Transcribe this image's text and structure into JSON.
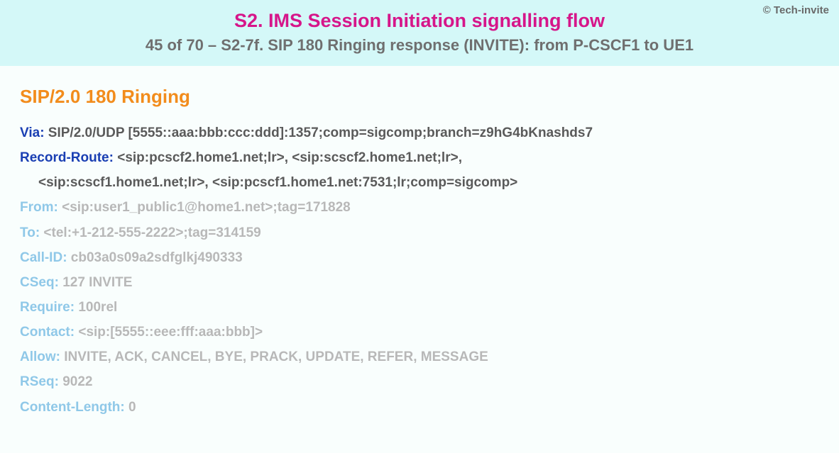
{
  "copyright": "© Tech-invite",
  "title": "S2. IMS Session Initiation signalling flow",
  "subtitle": "45 of 70 – S2-7f. SIP 180 Ringing response (INVITE): from P-CSCF1 to UE1",
  "status_line": "SIP/2.0 180 Ringing",
  "headers": {
    "via": {
      "label": "Via",
      "value": "SIP/2.0/UDP [5555::aaa:bbb:ccc:ddd]:1357;comp=sigcomp;branch=z9hG4bKnashds7"
    },
    "record_route": {
      "label": "Record-Route",
      "value_line1": "<sip:pcscf2.home1.net;lr>, <sip:scscf2.home1.net;lr>,",
      "value_line2": "<sip:scscf1.home1.net;lr>, <sip:pcscf1.home1.net:7531;lr;comp=sigcomp>"
    },
    "from": {
      "label": "From",
      "value": "<sip:user1_public1@home1.net>;tag=171828"
    },
    "to": {
      "label": "To",
      "value": "<tel:+1-212-555-2222>;tag=314159"
    },
    "call_id": {
      "label": "Call-ID",
      "value": "cb03a0s09a2sdfglkj490333"
    },
    "cseq": {
      "label": "CSeq",
      "value": "127 INVITE"
    },
    "require": {
      "label": "Require",
      "value": "100rel"
    },
    "contact": {
      "label": "Contact",
      "value": "<sip:[5555::eee:fff:aaa:bbb]>"
    },
    "allow": {
      "label": "Allow",
      "value": "INVITE, ACK, CANCEL, BYE, PRACK, UPDATE, REFER, MESSAGE"
    },
    "rseq": {
      "label": "RSeq",
      "value": "9022"
    },
    "content_length": {
      "label": "Content-Length",
      "value": "0"
    }
  }
}
